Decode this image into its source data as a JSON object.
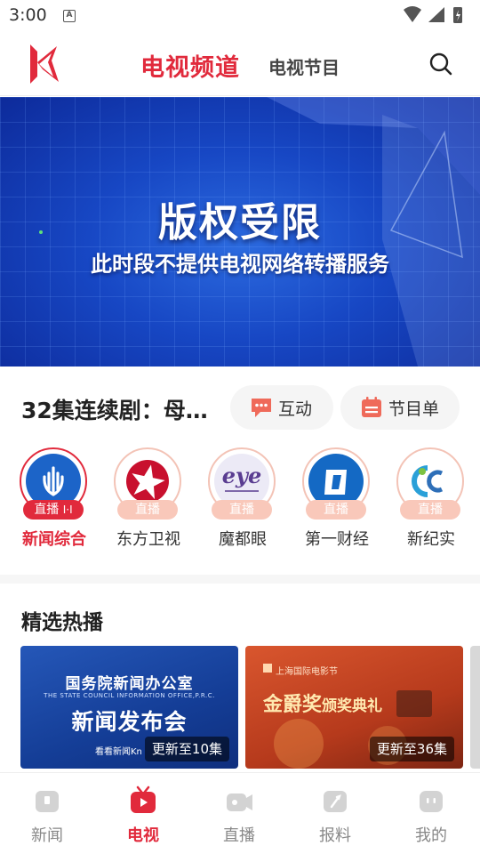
{
  "status_bar": {
    "time": "3:00",
    "notification_letter": "A"
  },
  "header": {
    "tabs": [
      {
        "label": "电视频道",
        "active": true
      },
      {
        "label": "电视节目",
        "active": false
      }
    ],
    "accent_color": "#e12a3c"
  },
  "banner": {
    "title": "版权受限",
    "subtitle": "此时段不提供电视网络转播服务"
  },
  "now_playing": {
    "text": "32集连续剧：母…",
    "buttons": [
      {
        "label": "互动",
        "icon": "chat-icon"
      },
      {
        "label": "节目单",
        "icon": "calendar-icon"
      }
    ]
  },
  "channels": [
    {
      "name": "新闻综合",
      "live": "直播",
      "active": true,
      "icon": "news-channel-logo"
    },
    {
      "name": "东方卫视",
      "live": "直播",
      "active": false,
      "icon": "dragon-tv-logo"
    },
    {
      "name": "魔都眼",
      "live": "直播",
      "active": false,
      "icon": "eye-logo",
      "logo_text": "eye"
    },
    {
      "name": "第一财经",
      "live": "直播",
      "active": false,
      "icon": "yicai-logo"
    },
    {
      "name": "新纪实",
      "live": "直播",
      "active": false,
      "icon": "documentary-logo"
    }
  ],
  "featured": {
    "title": "精选热播",
    "cards": [
      {
        "line1": "国务院新闻办公室",
        "line2": "THE STATE COUNCIL INFORMATION OFFICE,P.R.C.",
        "line3": "新闻发布会",
        "brand": "看看新闻Kn",
        "badge": "更新至10集"
      },
      {
        "org": "上海国际电影节",
        "title_main": "金爵奖",
        "title_sub": "颁奖典礼",
        "badge": "更新至36集"
      }
    ]
  },
  "bottom_nav": [
    {
      "label": "新闻",
      "icon": "news-icon",
      "active": false
    },
    {
      "label": "电视",
      "icon": "tv-icon",
      "active": true
    },
    {
      "label": "直播",
      "icon": "live-camera-icon",
      "active": false
    },
    {
      "label": "报料",
      "icon": "report-icon",
      "active": false
    },
    {
      "label": "我的",
      "icon": "profile-icon",
      "active": false
    }
  ]
}
